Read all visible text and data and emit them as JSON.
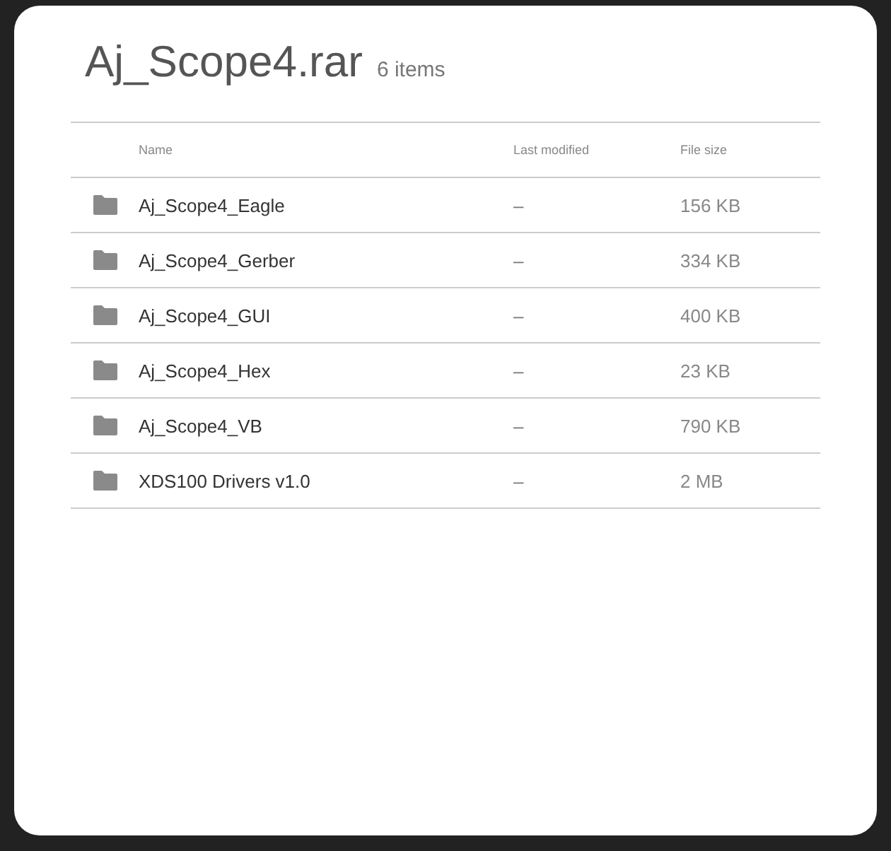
{
  "dialog": {
    "title": "Aj_Scope4.rar",
    "item_count": "6 items"
  },
  "table": {
    "columns": [
      "Name",
      "Last modified",
      "File size"
    ],
    "rows": [
      {
        "kind": "folder",
        "name": "Aj_Scope4_Eagle",
        "modified": "–",
        "size": "156 KB"
      },
      {
        "kind": "folder",
        "name": "Aj_Scope4_Gerber",
        "modified": "–",
        "size": "334 KB"
      },
      {
        "kind": "folder",
        "name": "Aj_Scope4_GUI",
        "modified": "–",
        "size": "400 KB"
      },
      {
        "kind": "folder",
        "name": "Aj_Scope4_Hex",
        "modified": "–",
        "size": "23 KB"
      },
      {
        "kind": "folder",
        "name": "Aj_Scope4_VB",
        "modified": "–",
        "size": "790 KB"
      },
      {
        "kind": "folder",
        "name": "XDS100 Drivers v1.0",
        "modified": "–",
        "size": "2 MB"
      }
    ]
  }
}
